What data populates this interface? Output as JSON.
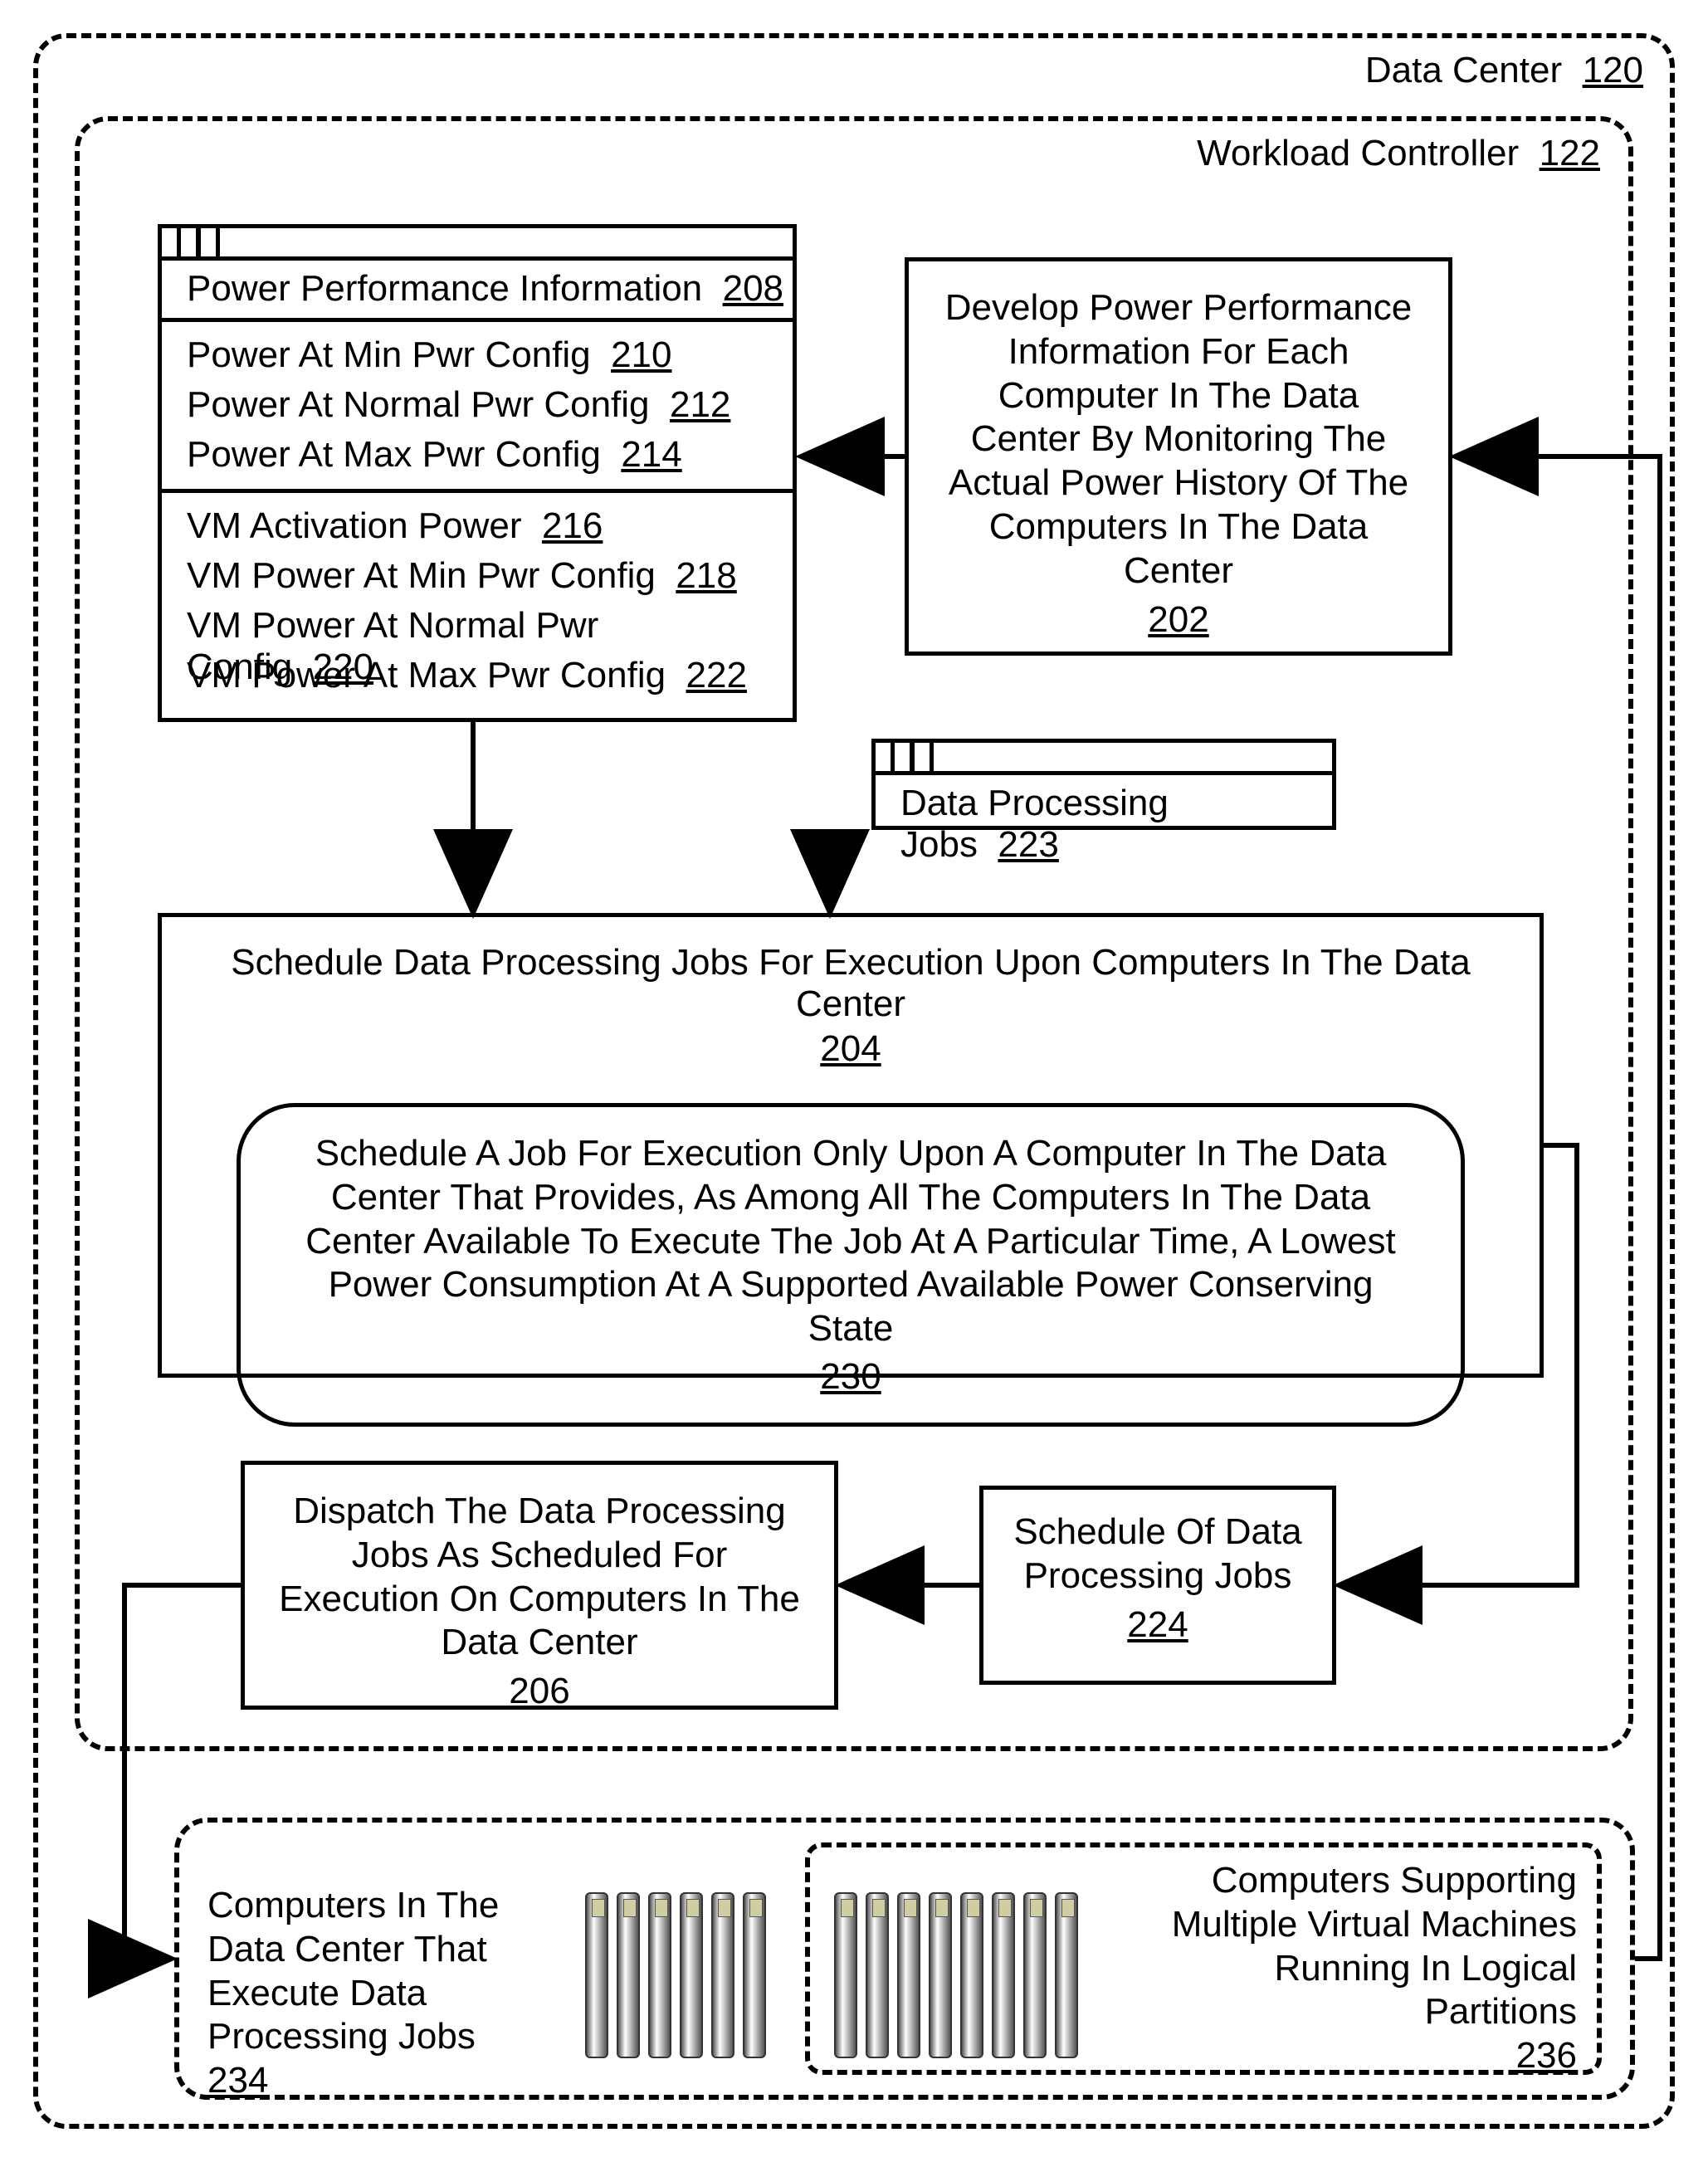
{
  "outer": {
    "label": "Data Center",
    "ref": "120"
  },
  "controller": {
    "label": "Workload Controller",
    "ref": "122"
  },
  "ppi": {
    "title": "Power Performance Information",
    "ref": "208",
    "rows": [
      {
        "t": "Power At Min Pwr Config",
        "r": "210"
      },
      {
        "t": "Power At Normal Pwr Config",
        "r": "212"
      },
      {
        "t": "Power At Max Pwr Config",
        "r": "214"
      },
      {
        "t": "VM Activation Power",
        "r": "216"
      },
      {
        "t": "VM Power At Min Pwr Config",
        "r": "218"
      },
      {
        "t": "VM Power At Normal Pwr Config",
        "r": "220"
      },
      {
        "t": "VM Power At Max Pwr Config",
        "r": "222"
      }
    ]
  },
  "develop": {
    "text": "Develop Power Performance Information For Each Computer In The Data Center By Monitoring The Actual Power History Of The Computers In The Data Center",
    "ref": "202"
  },
  "jobs": {
    "title": "Data Processing Jobs",
    "ref": "223"
  },
  "schedule": {
    "title": "Schedule Data Processing Jobs For Execution Upon Computers In The Data Center",
    "ref": "204",
    "inner": {
      "text": "Schedule A Job For Execution Only Upon A Computer In The Data Center That Provides, As Among All The Computers In The Data Center Available To Execute The Job At A Particular Time, A Lowest Power Consumption At A Supported Available Power Conserving State",
      "ref": "230"
    }
  },
  "dispatch": {
    "text": "Dispatch The Data Processing Jobs As Scheduled For Execution On Computers In The Data Center",
    "ref": "206"
  },
  "schedOf": {
    "text": "Schedule Of Data Processing Jobs",
    "ref": "224"
  },
  "computers": {
    "left": {
      "text": "Computers In The Data Center That Execute Data Processing Jobs",
      "ref": "234"
    },
    "right": {
      "text": "Computers Supporting Multiple Virtual Machines Running In Logical Partitions",
      "ref": "236"
    }
  }
}
